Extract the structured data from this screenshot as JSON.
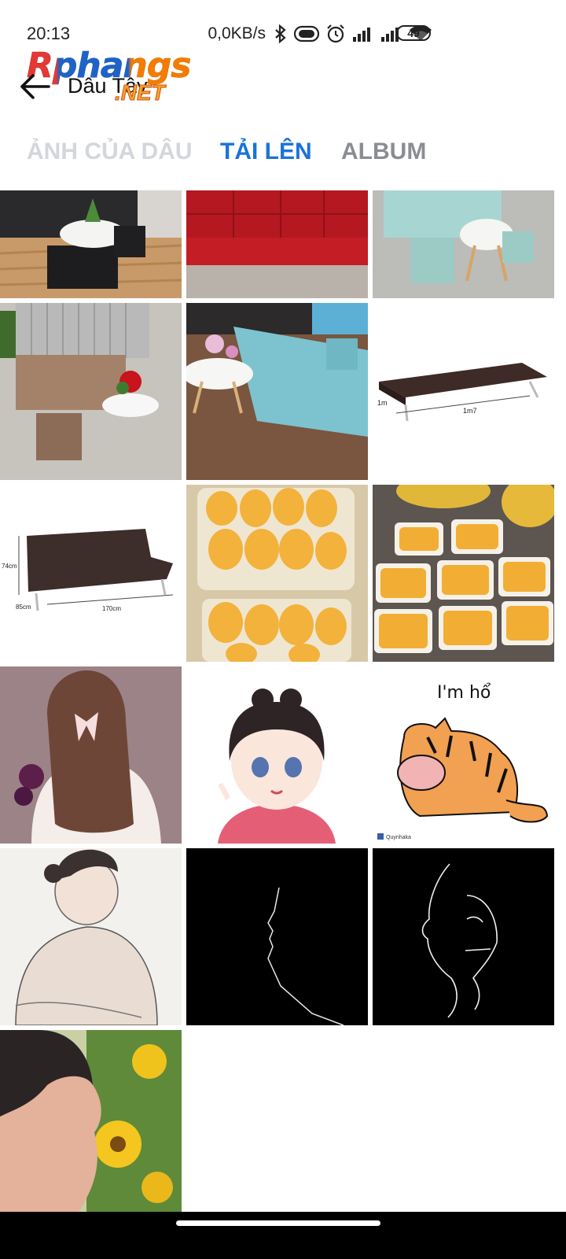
{
  "status_bar": {
    "time": "20:13",
    "network_speed": "0,0KB/s",
    "battery_level": "49",
    "icons": [
      "bluetooth-icon",
      "vibrate-icon",
      "alarm-icon",
      "signal-icon",
      "signal-icon",
      "wifi-icon",
      "battery-icon"
    ]
  },
  "app_bar": {
    "logo_main": "Rphangs",
    "logo_sub": "Dâu Tây",
    "logo_net": ".NET"
  },
  "tabs": [
    {
      "label": "ẢNH CỦA DÂU",
      "active": false
    },
    {
      "label": "TẢI LÊN",
      "active": true
    },
    {
      "label": "ALBUM",
      "active": false
    }
  ],
  "colors": {
    "tab_active": "#1a73d9",
    "tab_inactive": "#8a8d92",
    "tab_faded": "#d3d6db"
  },
  "photos": [
    {
      "subject": "black sofa set with white table",
      "caption": ""
    },
    {
      "subject": "red sofa bed",
      "caption": ""
    },
    {
      "subject": "mint sofa with round white table",
      "caption": ""
    },
    {
      "subject": "brown sofa with flowers",
      "caption": ""
    },
    {
      "subject": "light blue sofa with orchids",
      "caption": ""
    },
    {
      "subject": "brown sofa bed dimensions",
      "dim_a": "1m",
      "dim_b": "1m7"
    },
    {
      "subject": "brown sofa dimensions",
      "dim_a": "74cm",
      "dim_b": "85cm",
      "dim_c": "170cm"
    },
    {
      "subject": "jackfruit in boxes",
      "caption": ""
    },
    {
      "subject": "jackfruit trays",
      "caption": ""
    },
    {
      "subject": "girl with bow illustration",
      "caption": ""
    },
    {
      "subject": "chibi girl illustration",
      "caption": ""
    },
    {
      "subject": "tiger cat cartoon",
      "caption": "I'm hổ",
      "credit": "Quynhaka"
    },
    {
      "subject": "woman sketch",
      "caption": ""
    },
    {
      "subject": "face line art dark",
      "caption": ""
    },
    {
      "subject": "face line art white",
      "caption": ""
    },
    {
      "subject": "woman with sunflowers",
      "caption": ""
    }
  ]
}
